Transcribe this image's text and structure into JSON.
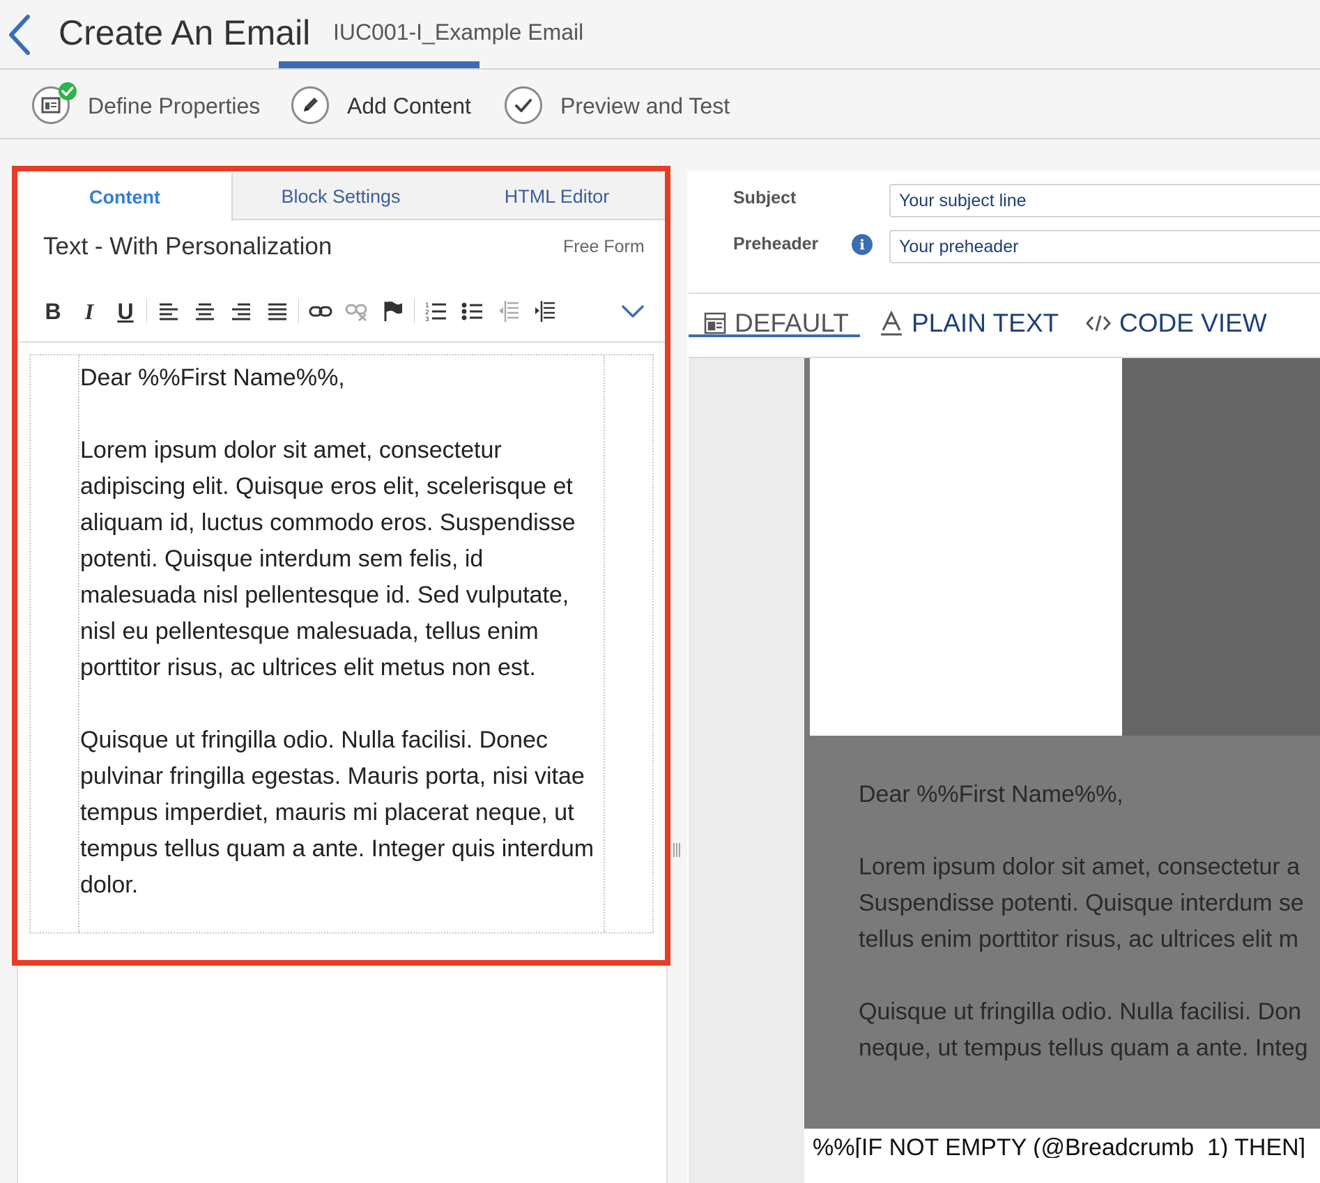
{
  "header": {
    "title": "Create An Email",
    "asset_name": "IUC001-I_Example Email"
  },
  "steps": [
    {
      "label": "Define Properties",
      "completed": true
    },
    {
      "label": "Add Content",
      "active": true
    },
    {
      "label": "Preview and Test"
    }
  ],
  "editor_panel": {
    "tabs": [
      {
        "label": "Content",
        "active": true
      },
      {
        "label": "Block Settings"
      },
      {
        "label": "HTML Editor"
      }
    ],
    "block_title": "Text - With Personalization",
    "block_type": "Free Form",
    "toolbar": {
      "bold": "B",
      "italic": "I",
      "underline": "U",
      "tools": [
        "align-left",
        "align-center",
        "align-right",
        "justify",
        "insert-link",
        "remove-link",
        "anchor-flag",
        "numbered-list",
        "bulleted-list",
        "decrease-indent",
        "increase-indent",
        "expand-toolbar"
      ]
    },
    "content": {
      "greeting": "Dear %%First Name%%,",
      "paragraph_1": "Lorem ipsum dolor sit amet, consectetur adipiscing elit. Quisque eros elit, scelerisque et aliquam id, luctus commodo eros. Suspendisse potenti. Quisque interdum sem felis, id malesuada nisl pellentesque id. Sed vulputate, nisl eu pellentesque malesuada, tellus enim porttitor risus, ac ultrices elit metus non est.",
      "paragraph_2": "Quisque ut fringilla odio. Nulla facilisi. Donec pulvinar fringilla egestas. Mauris porta, nisi vitae tempus imperdiet, mauris mi placerat neque, ut tempus tellus quam a ante. Integer quis interdum dolor."
    }
  },
  "message_fields": {
    "subject_label": "Subject",
    "subject_value": "Your subject line",
    "preheader_label": "Preheader",
    "preheader_value": "Your preheader"
  },
  "view_tabs": [
    {
      "label": "DEFAULT",
      "icon": "layout-icon",
      "active": true
    },
    {
      "label": "PLAIN TEXT",
      "icon": "text-a-icon"
    },
    {
      "label": "CODE VIEW",
      "icon": "code-icon"
    }
  ],
  "preview": {
    "greeting": "Dear %%First Name%%,",
    "line_1": "Lorem ipsum dolor sit amet, consectetur a",
    "line_2": "Suspendisse potenti. Quisque interdum se",
    "line_3": "tellus enim porttitor risus, ac ultrices elit m",
    "line_4": "Quisque ut fringilla odio. Nulla facilisi. Don",
    "line_5": "neque, ut tempus tellus quam a ante. Integ",
    "code_line": "%%[IF NOT EMPTY (@Breadcrumb_1) THEN]"
  },
  "colors": {
    "accent": "#3c6db3",
    "highlight": "#ea3b25",
    "success": "#2eb34a"
  }
}
